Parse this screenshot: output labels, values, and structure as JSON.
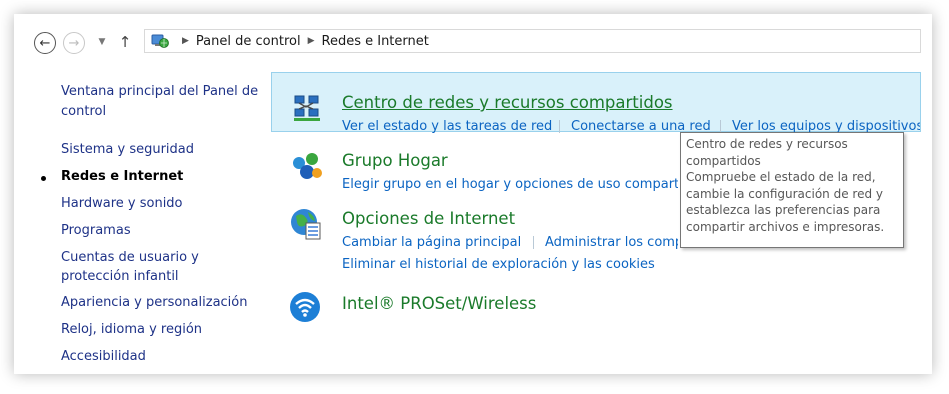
{
  "address_bar": {
    "breadcrumbs": [
      "Panel de control",
      "Redes e Internet"
    ],
    "back_icon": "back-arrow-icon",
    "forward_icon": "forward-arrow-icon",
    "up_icon": "up-arrow-icon"
  },
  "sidebar": {
    "items": [
      {
        "label_lines": [
          "Ventana principal del Panel de",
          "control"
        ],
        "current": false
      },
      {
        "label": "Sistema y seguridad",
        "current": false
      },
      {
        "label": "Redes e Internet",
        "current": true
      },
      {
        "label": "Hardware y sonido",
        "current": false
      },
      {
        "label": "Programas",
        "current": false
      },
      {
        "label_lines": [
          "Cuentas de usuario y",
          "protección infantil"
        ],
        "current": false
      },
      {
        "label": "Apariencia y personalización",
        "current": false
      },
      {
        "label": "Reloj, idioma y región",
        "current": false
      },
      {
        "label": "Accesibilidad",
        "current": false
      }
    ]
  },
  "categories": [
    {
      "title": "Centro de redes y recursos compartidos",
      "icon": "network-center-icon",
      "tasks": [
        "Ver el estado y las tareas de red",
        "Conectarse a una red",
        "Ver los equipos y dispositivos"
      ]
    },
    {
      "title": "Grupo Hogar",
      "icon": "homegroup-icon",
      "tasks": [
        "Elegir grupo en el hogar y opciones de uso compartido"
      ]
    },
    {
      "title": "Opciones de Internet",
      "icon": "internet-options-icon",
      "tasks": [
        "Cambiar la página principal",
        "Administrar los complementos",
        "Eliminar el historial de exploración y las cookies"
      ]
    },
    {
      "title": "Intel® PROSet/Wireless",
      "icon": "wireless-icon",
      "tasks": []
    }
  ],
  "tooltip": {
    "lines": [
      "Centro de redes y recursos",
      "compartidos",
      "Compruebe el estado de la red,",
      "cambie la configuración de red y",
      "establezca las preferencias para",
      "compartir archivos e impresoras."
    ]
  },
  "colors": {
    "link": "#0b64c2",
    "category_title": "#1a7a2a",
    "sidebar_link": "#1e3287",
    "highlight": "#d9f1fa"
  }
}
